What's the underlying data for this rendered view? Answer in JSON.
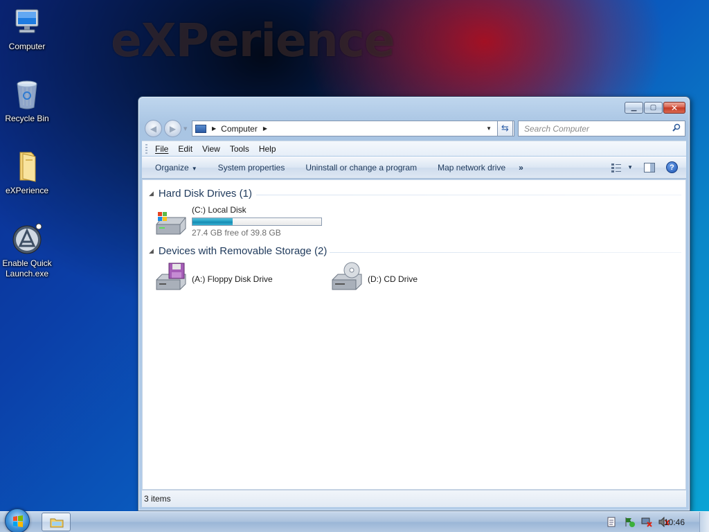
{
  "desktop": {
    "watermark": "eXPerience",
    "icons": [
      {
        "label": "Computer",
        "icon": "computer-icon"
      },
      {
        "label": "Recycle Bin",
        "icon": "recycle-bin-icon"
      },
      {
        "label": "eXPerience",
        "icon": "folder-icon"
      },
      {
        "label": "Enable Quick Launch.exe",
        "icon": "quick-launch-icon"
      }
    ]
  },
  "window": {
    "address": {
      "crumb": "Computer"
    },
    "search": {
      "placeholder": "Search Computer"
    },
    "menu": {
      "file": "File",
      "edit": "Edit",
      "view": "View",
      "tools": "Tools",
      "help": "Help"
    },
    "commands": {
      "organize": "Organize",
      "system_properties": "System properties",
      "uninstall": "Uninstall or change a program",
      "map_drive": "Map network drive",
      "more": "»"
    },
    "groups": {
      "hdd": {
        "title": "Hard Disk Drives (1)",
        "drives": [
          {
            "name": "(C:) Local Disk",
            "free_text": "27.4 GB free of 39.8 GB",
            "used_fraction": 0.31
          }
        ]
      },
      "removable": {
        "title": "Devices with Removable Storage (2)",
        "drives": [
          {
            "name": "(A:) Floppy Disk Drive",
            "icon": "floppy-drive-icon"
          },
          {
            "name": "(D:) CD Drive",
            "icon": "cd-drive-icon"
          }
        ]
      }
    },
    "status": "3 items"
  },
  "taskbar": {
    "clock": "10:46"
  },
  "colors": {
    "accent": "#1e395b",
    "disk_bar": "#1f9cc1"
  }
}
